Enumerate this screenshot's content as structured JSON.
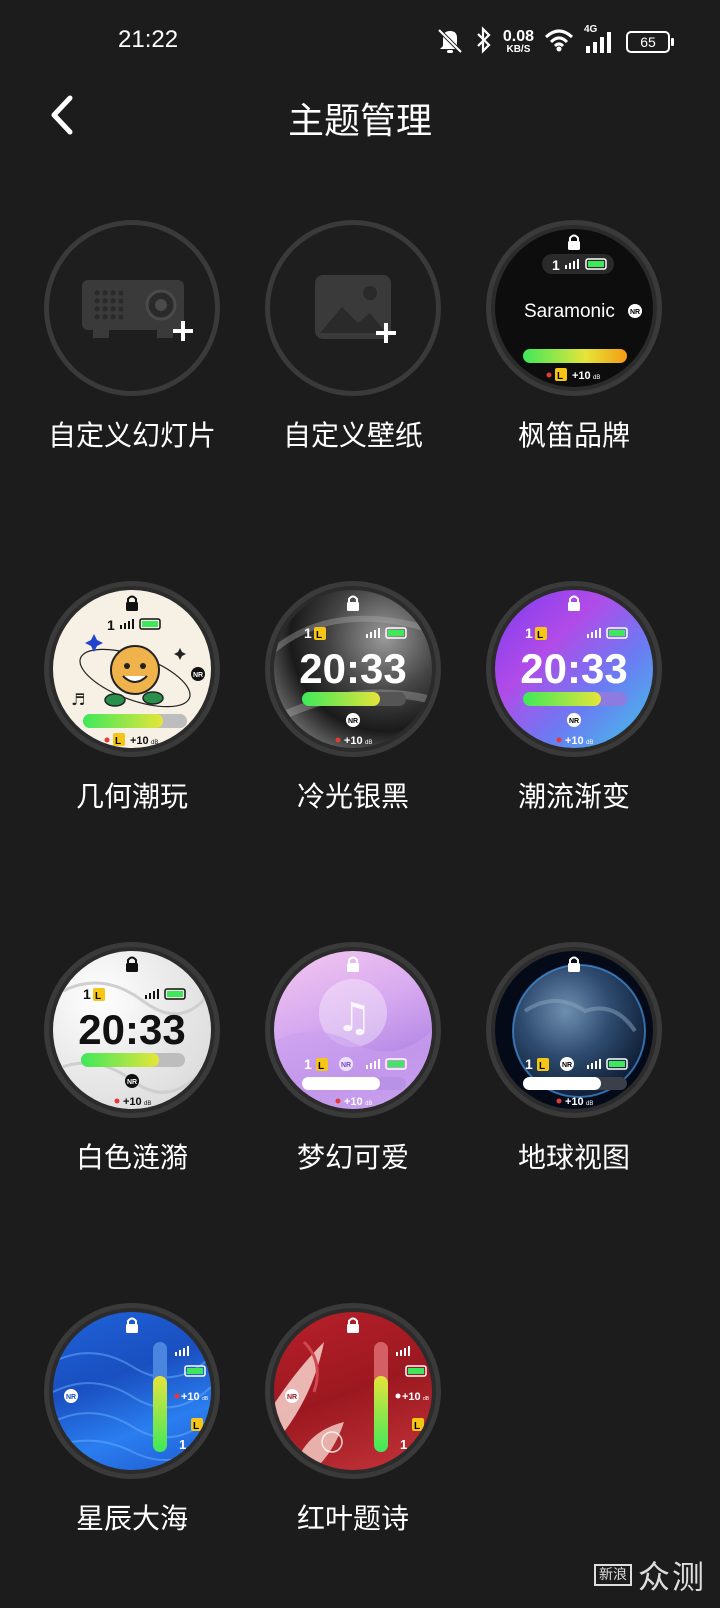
{
  "status_bar": {
    "time": "21:22",
    "net_speed_value": "0.08",
    "net_speed_unit": "KB/S",
    "network": "4G",
    "battery": "65"
  },
  "header": {
    "title": "主题管理",
    "back_icon": "chevron-left-icon"
  },
  "themes": [
    {
      "label": "自定义幻灯片",
      "icon": "projector-add-icon"
    },
    {
      "label": "自定义壁纸",
      "icon": "image-add-icon"
    },
    {
      "label": "枫笛品牌",
      "face_text": "Saramonic",
      "channel": "1",
      "gain": "+10",
      "gain_unit": "dB",
      "nr": "NR",
      "l": "L"
    },
    {
      "label": "几何潮玩",
      "channel": "1",
      "gain": "+10",
      "gain_unit": "dB",
      "nr": "NR",
      "l": "L"
    },
    {
      "label": "冷光银黑",
      "time": "20:33",
      "channel": "1",
      "gain": "+10",
      "gain_unit": "dB",
      "nr": "NR",
      "l": "L"
    },
    {
      "label": "潮流渐变",
      "time": "20:33",
      "channel": "1",
      "gain": "+10",
      "gain_unit": "dB",
      "nr": "NR",
      "l": "L"
    },
    {
      "label": "白色涟漪",
      "time": "20:33",
      "channel": "1",
      "gain": "+10",
      "gain_unit": "dB",
      "nr": "NR",
      "l": "L"
    },
    {
      "label": "梦幻可爱",
      "channel": "1",
      "gain": "+10",
      "gain_unit": "dB",
      "nr": "NR",
      "l": "L"
    },
    {
      "label": "地球视图",
      "channel": "1",
      "gain": "+10",
      "gain_unit": "dB",
      "nr": "NR",
      "l": "L"
    },
    {
      "label": "星辰大海",
      "channel": "1",
      "gain": "+10",
      "gain_unit": "dB",
      "nr": "NR",
      "l": "L"
    },
    {
      "label": "红叶题诗",
      "channel": "1",
      "gain": "+10",
      "gain_unit": "dB",
      "nr": "NR",
      "l": "L"
    }
  ],
  "watermark": {
    "box_text": "新浪",
    "text": "众测"
  },
  "colors": {
    "background": "#1c1c1c",
    "battery_green": "#3ee85a",
    "badge_yellow": "#f5c518",
    "rec_red": "#e53935"
  }
}
